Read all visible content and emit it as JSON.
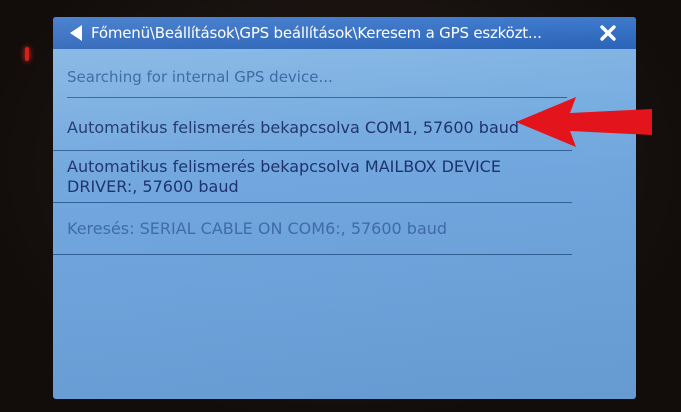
{
  "titlebar": {
    "path": "Főmenü\\Beállítások\\GPS beállítások\\Keresem a GPS eszközt..."
  },
  "status": {
    "text": "Searching for internal GPS device..."
  },
  "list": {
    "items": [
      {
        "label": "Automatikus felismerés bekapcsolva COM1, 57600 baud"
      },
      {
        "label": "Automatikus felismerés bekapcsolva MAILBOX DEVICE DRIVER:, 57600 baud"
      },
      {
        "label": "Keresés: SERIAL CABLE ON COM6:, 57600 baud"
      }
    ]
  },
  "colors": {
    "screen_bg": "#6fa6de",
    "titlebar_bg": "#2563be",
    "arrow": "#e4141c",
    "led": "#d62018"
  },
  "icons": {
    "back": "back-arrow-icon",
    "close": "close-icon"
  }
}
